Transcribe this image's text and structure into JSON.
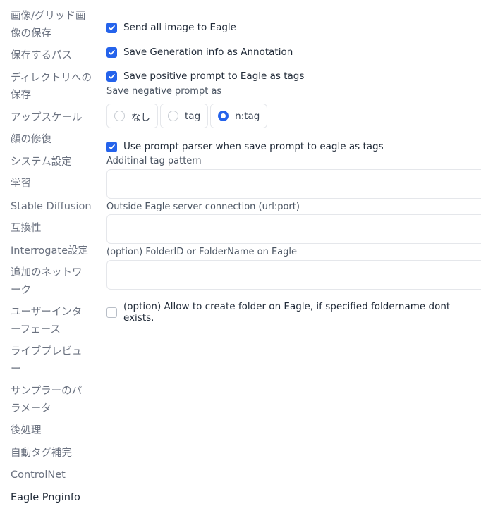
{
  "sidebar": {
    "items": [
      {
        "label": "画像/グリッド画像の保存"
      },
      {
        "label": "保存するパス"
      },
      {
        "label": "ディレクトリへの保存"
      },
      {
        "label": "アップスケール"
      },
      {
        "label": "顔の修復"
      },
      {
        "label": "システム設定"
      },
      {
        "label": "学習"
      },
      {
        "label": "Stable Diffusion"
      },
      {
        "label": "互換性"
      },
      {
        "label": "Interrogate設定"
      },
      {
        "label": "追加のネットワーク"
      },
      {
        "label": "ユーザーインターフェース"
      },
      {
        "label": "ライブプレビュー"
      },
      {
        "label": "サンプラーのパラメータ"
      },
      {
        "label": "後処理"
      },
      {
        "label": "自動タグ補完"
      },
      {
        "label": "ControlNet"
      },
      {
        "label": "Eagle Pnginfo"
      }
    ],
    "active": "Eagle Pnginfo"
  },
  "settings": {
    "send_all_image": {
      "label": "Send all image to Eagle",
      "checked": true
    },
    "save_generation_info": {
      "label": "Save Generation info as Annotation",
      "checked": true
    },
    "save_positive_prompt": {
      "label": "Save positive prompt to Eagle as tags",
      "checked": true
    },
    "negative_prompt": {
      "label": "Save negative prompt as",
      "options": [
        "なし",
        "tag",
        "n:tag"
      ],
      "selected": "n:tag"
    },
    "use_prompt_parser": {
      "label": "Use prompt parser when save prompt to eagle as tags",
      "checked": true
    },
    "additional_tag_pattern": {
      "label": "Additinal tag pattern",
      "value": ""
    },
    "outside_server": {
      "label": "Outside Eagle server connection (url:port)",
      "value": ""
    },
    "folder_id": {
      "label": "(option) FolderID or FolderName on Eagle",
      "value": ""
    },
    "allow_create_folder": {
      "label": "(option) Allow to create folder on Eagle, if specified foldername dont exists.",
      "checked": false
    }
  },
  "colors": {
    "accent": "#2563eb",
    "border": "#e5e7eb",
    "muted_text": "#6b7280"
  }
}
